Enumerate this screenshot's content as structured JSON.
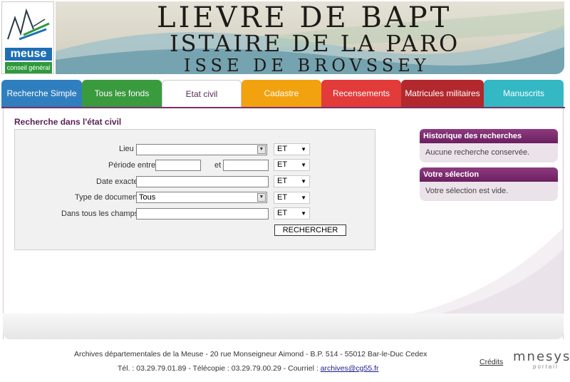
{
  "logo": {
    "word": "meuse",
    "subtitle": "conseil général"
  },
  "banner": {
    "lines": [
      "LIEVRE DE BAPT",
      "ISTAIRE DE LA PARO",
      "ISSE DE BROVSSEY"
    ]
  },
  "tabs": [
    {
      "label": "Recherche Simple",
      "color": "#2f7fbf",
      "active": false
    },
    {
      "label": "Tous les fonds",
      "color": "#3a9a3e",
      "active": false
    },
    {
      "label": "Etat civil",
      "color": "#ffffff",
      "active": true
    },
    {
      "label": "Cadastre",
      "color": "#f2a20f",
      "active": false
    },
    {
      "label": "Recensements",
      "color": "#e23b3a",
      "active": false
    },
    {
      "label": "Matricules militaires",
      "color": "#b2282d",
      "active": false
    },
    {
      "label": "Manuscrits",
      "color": "#33b8c4",
      "active": false
    }
  ],
  "page_title": "Recherche dans l'état civil",
  "form": {
    "lieu_label": "Lieu",
    "periode_label": "Période",
    "entre_label": "entre",
    "et_label": "et",
    "date_label": "Date exacte",
    "type_label": "Type de document",
    "type_value": "Tous",
    "all_fields_label": "Dans tous les champs",
    "operator": "ET",
    "search_button": "RECHERCHER"
  },
  "history": {
    "title": "Historique des recherches",
    "body": "Aucune recherche conservée."
  },
  "selection": {
    "title": "Votre sélection",
    "body": "Votre sélection est vide."
  },
  "footer": {
    "address": "Archives départementales de la Meuse - 20 rue Monseigneur Aimond - B.P. 514 - 55012 Bar-le-Duc Cedex",
    "phone": "Tél. : 03.29.79.01.89 - Télécopie : 03.29.79.00.29 - Courriel : ",
    "email": "archives@cg55.fr",
    "credits": "Crédits",
    "brand": "mnesys",
    "brand_sub": "portail"
  },
  "colors": {
    "accent": "#6b2060",
    "tab_line": "#7a2f69"
  }
}
